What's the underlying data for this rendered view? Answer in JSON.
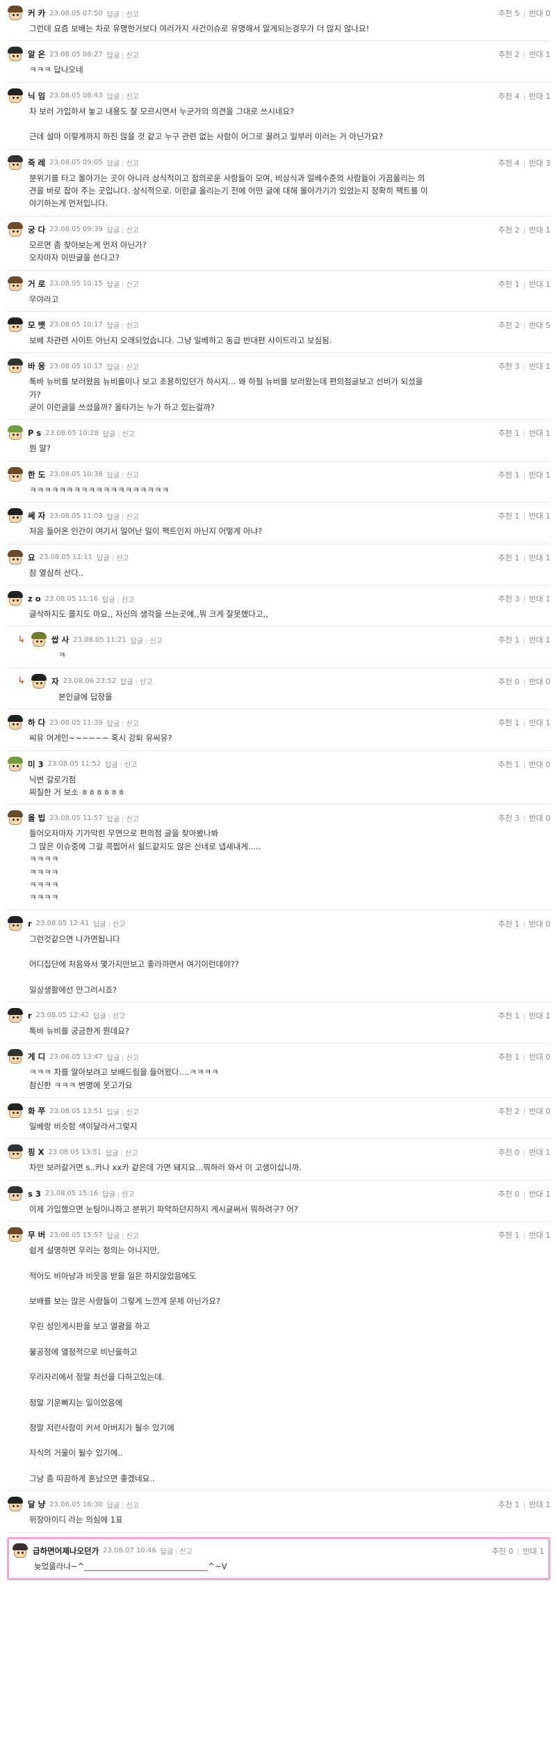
{
  "vote_up_label": "추천",
  "vote_down_label": "반대",
  "reply_label": "답글",
  "report_label": "신고",
  "comments": [
    {
      "author": "커 카",
      "date": "23.08.05 07:50",
      "up": "5",
      "down": "0",
      "reply": false,
      "highlight": false,
      "helmet": "#6b4a2a",
      "lines": [
        "그런데 요즘 보배는 차로 유명한거보다 여러가지 사건이슈로 유명해서 알게되는경우가 더 많지 않나요!"
      ]
    },
    {
      "author": "알 온",
      "date": "23.08.05 08:27",
      "up": "2",
      "down": "1",
      "reply": false,
      "highlight": false,
      "helmet": "#2b2b2b",
      "lines": [
        "ㅋㅋㅋ 답나오네"
      ]
    },
    {
      "author": "닉 임",
      "date": "23.08.05 08:43",
      "up": "4",
      "down": "1",
      "reply": false,
      "highlight": false,
      "helmet": "#222222",
      "lines": [
        "차 보러 가입하셔 놓고 내용도 잘 모르시면서 누군가의 의견을 그대로 쓰시네요?",
        "",
        "근데 설마 이렇게까지 하진 않을 것 같고 누구 관련 없는 사람이 어그로 끌려고 일부러 이러는 거 아닌가요?"
      ]
    },
    {
      "author": "죽 레",
      "date": "23.08.05 09:05",
      "up": "4",
      "down": "3",
      "reply": false,
      "highlight": false,
      "helmet": "#333333",
      "lines": [
        "분위기를 타고 몰아가는 곳이 아니라 상식적이고 정의로운 사람들이 모여, 비상식과 일베수준의 사람들이 가끔올리는 의",
        "견을 바로 잡아 주는 곳입니다. 상식적으로. 이런글 올리는기 전에 어떤 글에 대해 몰아가기가 있었는지 정확히 팩트를 이",
        "야기하는게 먼저입니다."
      ]
    },
    {
      "author": "궁 다",
      "date": "23.08.05 09:39",
      "up": "2",
      "down": "1",
      "reply": false,
      "highlight": false,
      "helmet": "#6b4a2a",
      "lines": [
        "모르면 좀 찾아보는게 먼저 아닌가?",
        "오자마자 이딴글을 쓴다고?"
      ]
    },
    {
      "author": "거 로",
      "date": "23.08.05 10:15",
      "up": "1",
      "down": "1",
      "reply": false,
      "highlight": false,
      "helmet": "#6b4a2a",
      "lines": [
        "우야라고"
      ]
    },
    {
      "author": "모 뱃",
      "date": "23.08.05 10:17",
      "up": "2",
      "down": "5",
      "reply": false,
      "highlight": false,
      "helmet": "#222222",
      "lines": [
        "보배 차관련 사이트 아닌지 오래되었습니다. 그냥 일베하고 동급 반대편 사이트라고 보심됨."
      ]
    },
    {
      "author": "바 웅",
      "date": "23.08.05 10:17",
      "up": "3",
      "down": "1",
      "reply": false,
      "highlight": false,
      "helmet": "#333333",
      "lines": [
        "톡바 뉴비를 보러왔음 뉴비를이나 보고 조용히있던가 하시지... 왜 하필 뉴비를 보러왔는데 편의점글보고 선비가 되셨을",
        "가?",
        "굳이 이런글을 쓰셨을까? 올타가는 누가 하고 있는걸까?"
      ]
    },
    {
      "author": "P s",
      "date": "23.08.05 10:28",
      "up": "1",
      "down": "1",
      "reply": false,
      "highlight": false,
      "helmet": "#6f9e3c",
      "lines": [
        "뭔 말?"
      ]
    },
    {
      "author": "한 도",
      "date": "23.08.05 10:38",
      "up": "1",
      "down": "1",
      "reply": false,
      "highlight": false,
      "helmet": "#6b4a2a",
      "lines": [
        "ㅋㅋㅋㅋㅋㅋㅋㅋㅋㅋㅋㅋㅋㅋㅋㅋㅋㅋㅋ"
      ]
    },
    {
      "author": "쎄 자",
      "date": "23.08.05 11:03",
      "up": "1",
      "down": "1",
      "reply": false,
      "highlight": false,
      "helmet": "#222222",
      "lines": [
        "처음 들어온 인간이 여기서 일어난 일이 팩트인지 아닌지 어떻게 아냐?"
      ]
    },
    {
      "author": "요",
      "date": "23.08.05 11:11",
      "up": "1",
      "down": "1",
      "reply": false,
      "highlight": false,
      "helmet": "#6b4a2a",
      "lines": [
        "참 열심히 산다.."
      ]
    },
    {
      "author": "z o",
      "date": "23.08.05 11:16",
      "up": "3",
      "down": "1",
      "reply": false,
      "highlight": false,
      "helmet": "#222222",
      "lines": [
        "글삭하지도 쫄지도 마요,, 자신의 생각을 쓰는곳에,,뭐 크게 잘못했다고,,"
      ]
    },
    {
      "author": "쌉 사",
      "date": "23.08.05 11:21",
      "up": "1",
      "down": "1",
      "reply": true,
      "highlight": false,
      "helmet": "#6f7a2a",
      "lines": [
        "ㅋ"
      ]
    },
    {
      "author": "자",
      "date": "23.08.06 23:52",
      "up": "0",
      "down": "0",
      "reply": true,
      "highlight": false,
      "helmet": "#222222",
      "lines": [
        "본인글에 답장을"
      ]
    },
    {
      "author": "하 다",
      "date": "23.08.05 11:39",
      "up": "1",
      "down": "1",
      "reply": false,
      "highlight": false,
      "helmet": "#222222",
      "lines": [
        "씨유 어게인~~~~~~ 혹시 강퇴 유씨유?"
      ]
    },
    {
      "author": "미 3",
      "date": "23.08.05 11:52",
      "up": "1",
      "down": "0",
      "reply": false,
      "highlight": false,
      "helmet": "#6f9e3c",
      "lines": [
        "닉변 갈로기점",
        "찌질한 거 보소 ㅎㅎㅎㅎㅎㅎ"
      ]
    },
    {
      "author": "올 빕",
      "date": "23.08.05 11:57",
      "up": "3",
      "down": "0",
      "reply": false,
      "highlight": false,
      "helmet": "#6b4a2a",
      "lines": [
        "들어오자마자 기가막힌 우연으로 편의점 글을 찾아봤나봐",
        "그 많은 이슈중에 그걸 콕찝어서 쉴드같지도 않은 신네로 넵새내게.....",
        "ㅋㅋㅋㅋ",
        "ㅋㅋㅋㅋ",
        "ㅋㅋㅋㅋ",
        "ㅋㅋㅋㅋ"
      ]
    },
    {
      "author": "r",
      "date": "23.08.05 12:41",
      "up": "1",
      "down": "0",
      "reply": false,
      "highlight": false,
      "helmet": "#222222",
      "lines": [
        "그런것같으면 나가면됩니다",
        "",
        "어디집단에 처음와서 몇가지만보고 좋라까면서 여기이런데야??",
        "",
        "일상생활에선 안그러시죠?"
      ]
    },
    {
      "author": "r",
      "date": "23.08.05 12:42",
      "up": "1",
      "down": "1",
      "reply": false,
      "highlight": false,
      "helmet": "#222222",
      "lines": [
        "톡바 뉴비를 궁금한게 뭔데요?"
      ]
    },
    {
      "author": "게 디",
      "date": "23.08.05 13:47",
      "up": "1",
      "down": "0",
      "reply": false,
      "highlight": false,
      "helmet": "#333333",
      "lines": [
        "ㅋㅋㅋ 차를 알아보려고 보배드림을 들어왔다....ㅋㅋㅋㅋ",
        "참신한 ㅋㅋㅋ 변명에 웃고가요"
      ]
    },
    {
      "author": "화 쭈",
      "date": "23.08.05 13:51",
      "up": "2",
      "down": "0",
      "reply": false,
      "highlight": false,
      "helmet": "#222222",
      "lines": [
        "일베랑 비슷함 색이달라서그렇지"
      ]
    },
    {
      "author": "핑 X",
      "date": "23.08.05 13:51",
      "up": "0",
      "down": "1",
      "reply": false,
      "highlight": false,
      "helmet": "#333333",
      "lines": [
        "차만 보러갈거면 s..카나 xx카 같은데 가면 돼지요...뭐하러 와서 이 고생이십니까."
      ]
    },
    {
      "author": "s 3",
      "date": "23.08.05 15:16",
      "up": "0",
      "down": "1",
      "reply": false,
      "highlight": false,
      "helmet": "#333333",
      "lines": [
        "이제 가입했으면 눈팅이나하고 분위기 파악하던지하지 게시글써서 뭐하려구? 어?"
      ]
    },
    {
      "author": "무 버",
      "date": "23.08.05 15:57",
      "up": "1",
      "down": "1",
      "reply": false,
      "highlight": false,
      "helmet": "#6b4a2a",
      "lines": [
        "쉽게 설명하면 우리는 정의는 아니지만,",
        "",
        "적어도 비아냥과 비웃음 받을 일은 하지않았음에도",
        "",
        "보배를 보는 많은 사람들이 그렇게 느낀게 문제 아닌가요?",
        "",
        "우린 성인게시판을 보고 열광을 하고",
        "",
        "불공정에 열정적으로 비난을하고",
        "",
        "우리자리에서 정말 최선을 다하고있는데.",
        "",
        "정말 기운빠지는 일이었음에",
        "",
        "정말 저런사람이 커서 아버지가 될수 있기에",
        "",
        "자식의 거울이 될수 있기에..",
        "",
        "그냥 좀 따끔하게 혼났으면 좋겠네요.."
      ]
    },
    {
      "author": "달 냥",
      "date": "23.08.05 16:30",
      "up": "1",
      "down": "1",
      "reply": false,
      "highlight": false,
      "helmet": "#222222",
      "lines": [
        "위장아이디 라는 의심에 1표"
      ]
    },
    {
      "author": "급하면어제나오던가",
      "date": "23.08.07 10:46",
      "up": "0",
      "down": "1",
      "reply": false,
      "highlight": true,
      "helmet": "#333333",
      "lines": [
        "늦었을라나~^_______________________________^~V"
      ]
    }
  ]
}
